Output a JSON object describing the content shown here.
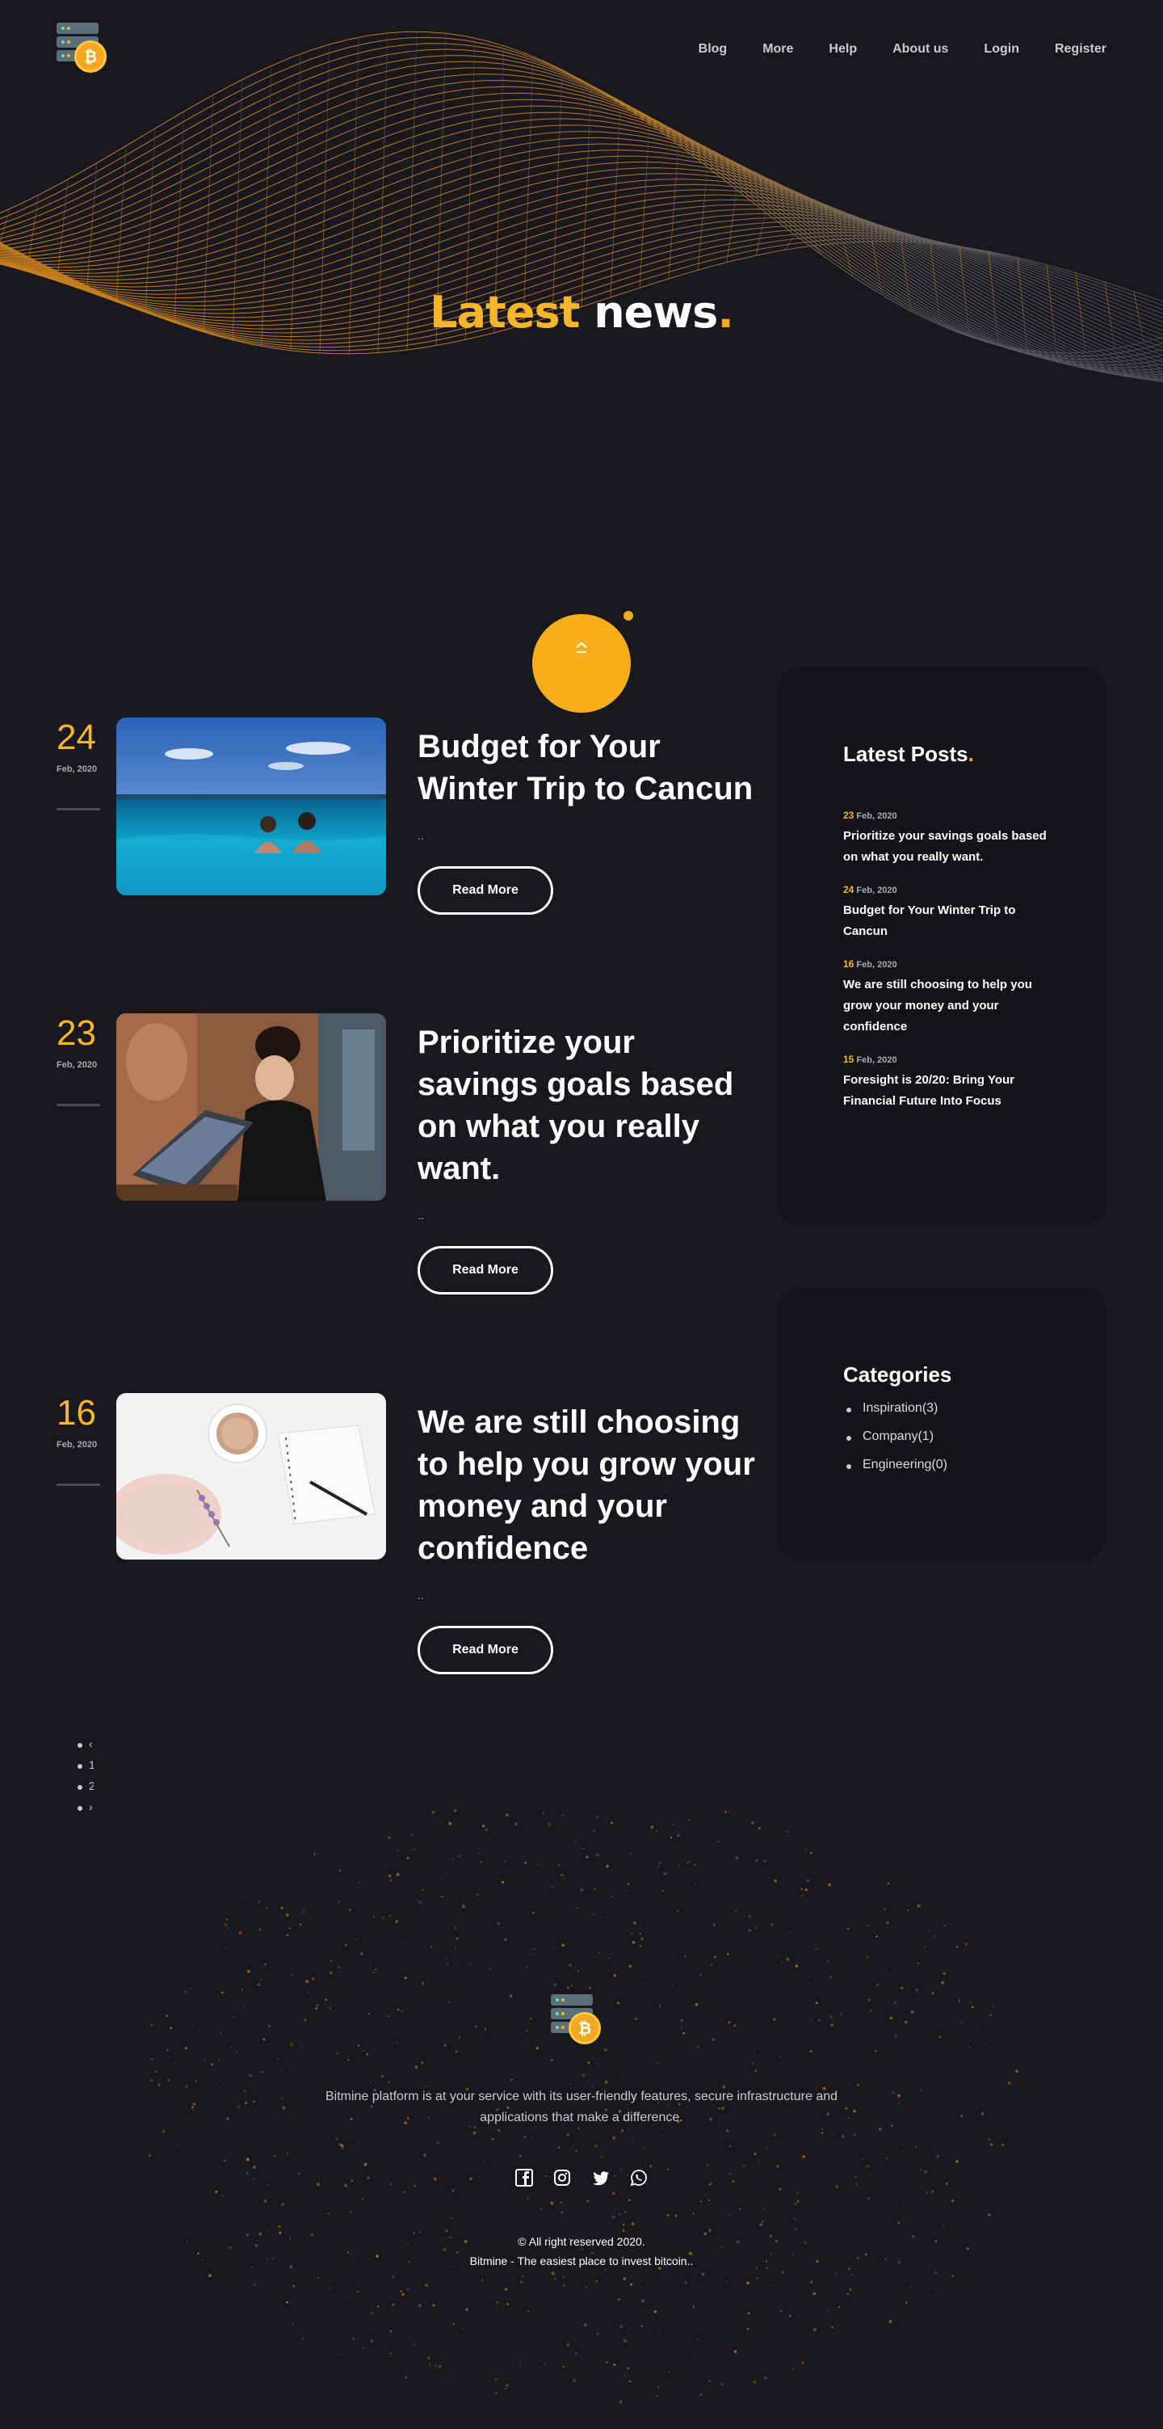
{
  "brand": {
    "name": "Bitmine",
    "coin_symbol": "₿",
    "accent": "#f7ae1a"
  },
  "nav": {
    "items": [
      {
        "label": "Blog"
      },
      {
        "label": "More"
      },
      {
        "label": "Help"
      },
      {
        "label": "About us"
      },
      {
        "label": "Login"
      },
      {
        "label": "Register"
      }
    ]
  },
  "hero": {
    "title_part1": "Latest",
    "title_part2": "news",
    "title_dot": "."
  },
  "scroll_up": {
    "icon": "double-chevron-up-icon",
    "glyph": "⌃"
  },
  "posts": [
    {
      "day": "24",
      "month": "Feb, 2020",
      "title": "Budget for Your Winter Trip to Cancun",
      "excerpt": "..",
      "button": "Read More",
      "image": "couple-infinity-pool"
    },
    {
      "day": "23",
      "month": "Feb, 2020",
      "title": "Prioritize your savings goals based on what you really want.",
      "excerpt": "..",
      "button": "Read More",
      "image": "woman-with-laptop"
    },
    {
      "day": "16",
      "month": "Feb, 2020",
      "title": "We are still choosing to help you grow your money and your confidence",
      "excerpt": "..",
      "button": "Read More",
      "image": "coffee-and-notebook-flatlay"
    }
  ],
  "latest_posts": {
    "heading": "Latest Posts",
    "heading_dot": ".",
    "items": [
      {
        "day": "23",
        "month": "Feb, 2020",
        "title": "Prioritize your savings goals based on what you really want."
      },
      {
        "day": "24",
        "month": "Feb, 2020",
        "title": "Budget for Your Winter Trip to Cancun"
      },
      {
        "day": "16",
        "month": "Feb, 2020",
        "title": "We are still choosing to help you grow your money and your confidence"
      },
      {
        "day": "15",
        "month": "Feb, 2020",
        "title": "Foresight is 20/20: Bring Your Financial Future Into Focus"
      }
    ]
  },
  "categories": {
    "heading": "Categories",
    "items": [
      {
        "label": "Inspiration(3)"
      },
      {
        "label": "Company(1)"
      },
      {
        "label": "Engineering(0)"
      }
    ]
  },
  "pagination": {
    "items": [
      "‹",
      "1",
      "2",
      "›"
    ]
  },
  "footer": {
    "description": "Bitmine platform is at your service with its user-friendly features, secure infrastructure and applications that make a difference.",
    "socials": [
      "facebook-icon",
      "instagram-icon",
      "twitter-icon",
      "whatsapp-icon"
    ],
    "copyright": "© All right reserved 2020.",
    "tagline": "Bitmine - The easiest place to invest bitcoin.."
  }
}
